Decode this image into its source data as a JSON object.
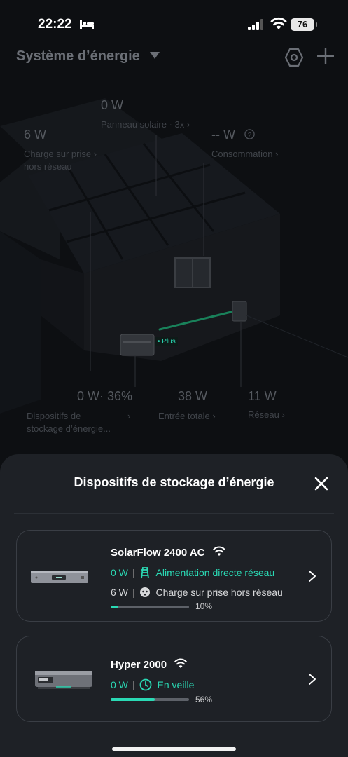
{
  "status_bar": {
    "time": "22:22",
    "battery": "76"
  },
  "header": {
    "title": "Système d’énergie"
  },
  "scene": {
    "solar": {
      "value": "0 W",
      "label": "Panneau solaire · 3x"
    },
    "offgrid_charge": {
      "value": "6 W",
      "label_line1": "Charge sur prise",
      "label_line2": "hors réseau"
    },
    "consumption": {
      "value": "-- W",
      "label": "Consommation"
    },
    "plus_tag": "• Plus",
    "storage": {
      "value": "0 W· 36%",
      "label_line1": "Dispositifs de",
      "label_line2": "stockage d’énergie..."
    },
    "total_input": {
      "value": "38 W",
      "label": "Entrée totale"
    },
    "grid": {
      "value": "11 W",
      "label": "Réseau"
    }
  },
  "sheet": {
    "title": "Dispositifs de stockage d’énergie",
    "devices": [
      {
        "name": "SolarFlow 2400 AC",
        "power1": "0 W",
        "mode1": "Alimentation directe réseau",
        "power2": "6 W",
        "mode2": "Charge sur prise hors réseau",
        "battery_percent": 10,
        "battery_label": "10%"
      },
      {
        "name": "Hyper 2000",
        "power1": "0 W",
        "mode1": "En veille",
        "battery_percent": 56,
        "battery_label": "56%"
      }
    ]
  },
  "colors": {
    "accent": "#2ad9b4",
    "sheet_bg": "#1e2126",
    "page_bg": "#0d0f12"
  }
}
